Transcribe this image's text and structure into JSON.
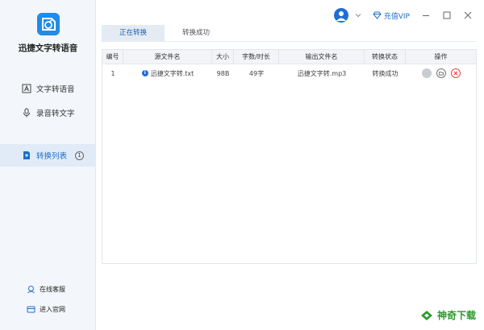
{
  "app": {
    "title": "迅捷文字转语音"
  },
  "sidebar": {
    "items": [
      {
        "label": "文字转语音",
        "icon": "text-to-speech-icon"
      },
      {
        "label": "录音转文字",
        "icon": "microphone-icon"
      },
      {
        "label": "转换列表",
        "icon": "convert-list-icon",
        "badge": "1",
        "active": true
      }
    ],
    "footer": [
      {
        "label": "在线客服",
        "icon": "customer-service-icon"
      },
      {
        "label": "进入官网",
        "icon": "website-icon"
      }
    ]
  },
  "topbar": {
    "vip_label": "充值VIP"
  },
  "tabs": [
    {
      "label": "正在转换",
      "active": true
    },
    {
      "label": "转换成功",
      "active": false
    }
  ],
  "table": {
    "headers": [
      "编号",
      "源文件名",
      "大小",
      "字数/时长",
      "输出文件名",
      "转换状态",
      "操作"
    ],
    "rows": [
      {
        "index": "1",
        "source": "迅捷文字转.txt",
        "size": "98B",
        "length": "49字",
        "output": "迅捷文字转.mp3",
        "status": "转换成功"
      }
    ]
  },
  "watermark": {
    "text": "神奇下载"
  },
  "colors": {
    "accent": "#1f6fd4",
    "sidebar_bg": "#f3f6fa",
    "delete": "#e24b3b",
    "watermark": "#2a9a2a"
  }
}
